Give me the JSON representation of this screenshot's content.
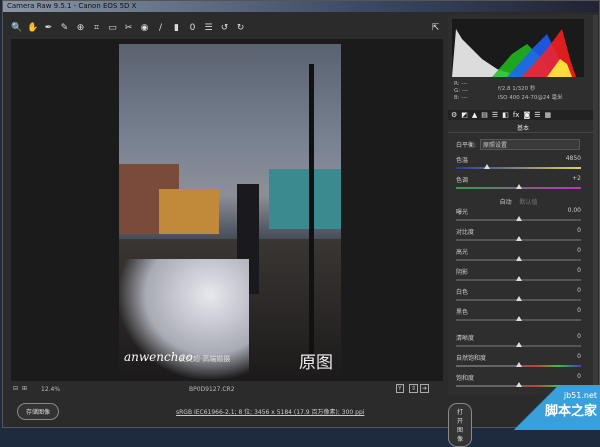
{
  "window": {
    "title": "Camera Raw 9.5.1 - Canon EOS 5D X"
  },
  "toolbar": {
    "tools": [
      "zoom-icon",
      "hand-icon",
      "white-balance-icon",
      "color-sampler-icon",
      "target-adjust-icon",
      "crop-icon",
      "straighten-icon",
      "spot-removal-icon",
      "red-eye-icon",
      "adjustment-brush-icon",
      "graduated-filter-icon",
      "radial-filter-icon",
      "preferences-icon",
      "rotate-left-icon",
      "rotate-right-icon"
    ]
  },
  "photo": {
    "watermark": "anwenchao",
    "watermark_sub": "安文超·高端婚摄",
    "overlay_label": "原图"
  },
  "status": {
    "zoom": "12.4%",
    "filename": "BP0D9127.CR2"
  },
  "footer": {
    "save_button": "存储图像",
    "workflow_link": "sRGB IEC61966-2.1; 8 位; 3456 x 5184 (17.9 百万像素); 300 ppi",
    "open_button": "打开图像"
  },
  "histogram": {
    "colors": [
      "#ffffff",
      "#2060ff",
      "#20c020",
      "#ff2020",
      "#ffff40",
      "#30e0e0"
    ]
  },
  "info": {
    "r": "R: ---",
    "g": "G: ---",
    "b": "B: ---",
    "line1": "f/2.8   1/320 秒",
    "line2": "ISO 400   24-70@24 毫米"
  },
  "panel": {
    "section": "基本",
    "wb_label": "白平衡:",
    "wb_value": "原照设置",
    "auto": "自动",
    "default": "默认值",
    "sliders": [
      {
        "label": "色温",
        "value": "4850",
        "pos": 0.25
      },
      {
        "label": "色调",
        "value": "+2",
        "pos": 0.5
      },
      {
        "label": "曝光",
        "value": "0.00",
        "pos": 0.5
      },
      {
        "label": "对比度",
        "value": "0",
        "pos": 0.5
      },
      {
        "label": "高光",
        "value": "0",
        "pos": 0.5
      },
      {
        "label": "阴影",
        "value": "0",
        "pos": 0.5
      },
      {
        "label": "白色",
        "value": "0",
        "pos": 0.5
      },
      {
        "label": "黑色",
        "value": "0",
        "pos": 0.5
      },
      {
        "label": "清晰度",
        "value": "0",
        "pos": 0.5
      },
      {
        "label": "自然饱和度",
        "value": "0",
        "pos": 0.5
      },
      {
        "label": "饱和度",
        "value": "0",
        "pos": 0.5
      }
    ]
  },
  "site_watermark": {
    "url": "jb51.net",
    "name": "脚本之家"
  }
}
